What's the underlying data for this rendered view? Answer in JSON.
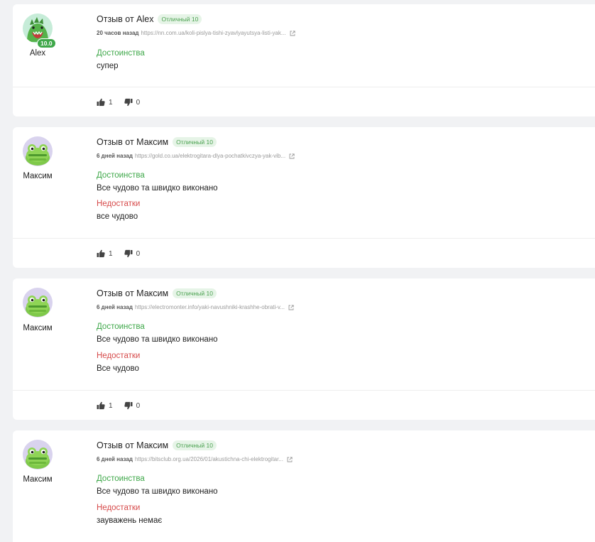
{
  "reviews": [
    {
      "author": "Alex",
      "title": "Отзыв от Alex",
      "rating": "Отличный 10",
      "score_badge": "10.0",
      "time": "20 часов назад",
      "link": "https://nn.com.ua/koli-pislya-tishi-zyavlyayutsya-listi-yak...",
      "pros_label": "Достоинства",
      "pros_text": "супер",
      "likes": "1",
      "dislikes": "0",
      "avatar_icon": "dragon-avatar-icon"
    },
    {
      "author": "Максим",
      "title": "Отзыв от Максим",
      "rating": "Отличный 10",
      "time": "6 дней назад",
      "link": "https://gold.co.ua/elektrogitara-dlya-pochatkivczya-yak-vib...",
      "pros_label": "Достоинства",
      "pros_text": "Все чудово та швидко виконано",
      "cons_label": "Недостатки",
      "cons_text": "все чудово",
      "likes": "1",
      "dislikes": "0",
      "avatar_icon": "frog-avatar-icon"
    },
    {
      "author": "Максим",
      "title": "Отзыв от Максим",
      "rating": "Отличный 10",
      "time": "6 дней назад",
      "link": "https://electromonter.info/yaki-navushniki-krashhe-obrati-v...",
      "pros_label": "Достоинства",
      "pros_text": "Все чудово та швидко виконано",
      "cons_label": "Недостатки",
      "cons_text": "Все чудово",
      "likes": "1",
      "dislikes": "0",
      "avatar_icon": "frog-avatar-icon"
    },
    {
      "author": "Максим",
      "title": "Отзыв от Максим",
      "rating": "Отличный 10",
      "time": "6 дней назад",
      "link": "https://bitsclub.org.ua/2026/01/akustichna-chi-elektrogitar...",
      "pros_label": "Достоинства",
      "pros_text": "Все чудово та швидко виконано",
      "cons_label": "Недостатки",
      "cons_text": "зауважень немає",
      "avatar_icon": "frog-avatar-icon"
    }
  ],
  "colors": {
    "pros": "#3fa84a",
    "cons": "#d64a4a",
    "badge_bg": "#e6f4e7",
    "background": "#f1f2f4"
  }
}
